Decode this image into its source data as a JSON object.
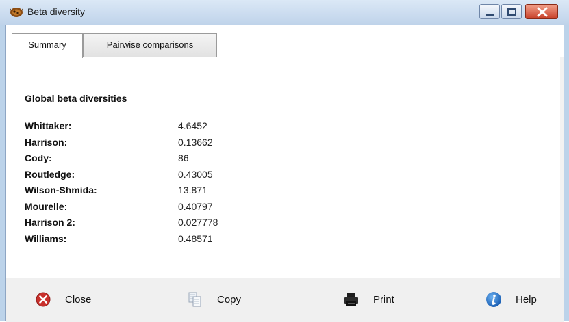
{
  "window": {
    "title": "Beta diversity",
    "controls": [
      "minimize",
      "maximize",
      "close"
    ]
  },
  "tabs": [
    {
      "label": "Summary",
      "active": true
    },
    {
      "label": "Pairwise comparisons",
      "active": false
    }
  ],
  "summary": {
    "heading": "Global beta diversities",
    "rows": [
      {
        "label": "Whittaker:",
        "value": "4.6452"
      },
      {
        "label": "Harrison:",
        "value": "0.13662"
      },
      {
        "label": "Cody:",
        "value": "86"
      },
      {
        "label": "Routledge:",
        "value": "0.43005"
      },
      {
        "label": "Wilson-Shmida:",
        "value": "13.871"
      },
      {
        "label": "Mourelle:",
        "value": "0.40797"
      },
      {
        "label": "Harrison 2:",
        "value": "0.027778"
      },
      {
        "label": "Williams:",
        "value": "0.48571"
      }
    ]
  },
  "toolbar": {
    "close_label": "Close",
    "copy_label": "Copy",
    "print_label": "Print",
    "help_label": "Help",
    "icons": {
      "close": "close-circle-icon",
      "copy": "copy-icon",
      "print": "printer-icon",
      "help": "info-icon"
    }
  }
}
